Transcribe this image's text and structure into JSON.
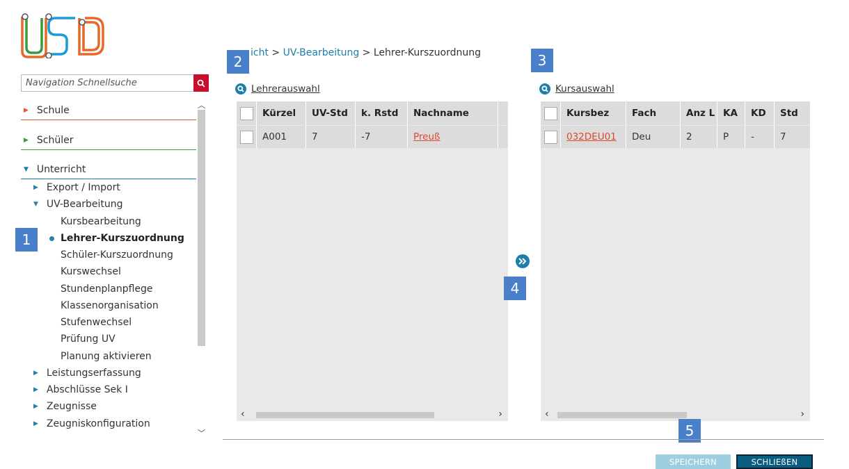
{
  "sidebar": {
    "search_placeholder": "Navigation Schnellsuche",
    "top_items": [
      {
        "label": "Schule",
        "color": "#e05a2b",
        "expanded": false
      },
      {
        "label": "Schüler",
        "color": "#3a9b3a",
        "expanded": false
      },
      {
        "label": "Unterricht",
        "color": "#1b7fa8",
        "expanded": true
      }
    ],
    "sub_items": [
      {
        "label": "Export / Import"
      },
      {
        "label": "UV-Bearbeitung"
      },
      {
        "label": "Leistungserfassung"
      },
      {
        "label": "Abschlüsse Sek I"
      },
      {
        "label": "Zeugnisse"
      },
      {
        "label": "Zeugniskonfiguration"
      }
    ],
    "uv_children": [
      {
        "label": "Kursbearbeitung",
        "active": false
      },
      {
        "label": "Lehrer-Kurszuordnung",
        "active": true
      },
      {
        "label": "Schüler-Kurszuordnung",
        "active": false
      },
      {
        "label": "Kurswechsel",
        "active": false
      },
      {
        "label": "Stundenplanpflege",
        "active": false
      },
      {
        "label": "Klassenorganisation",
        "active": false
      },
      {
        "label": "Stufenwechsel",
        "active": false
      },
      {
        "label": "Prüfung UV",
        "active": false
      },
      {
        "label": "Planung aktivieren",
        "active": false
      }
    ]
  },
  "badges": [
    "1",
    "2",
    "3",
    "4",
    "5"
  ],
  "breadcrumb": {
    "part1": "icht",
    "sep1": " > ",
    "part2": "UV-Bearbeitung",
    "sep2": " > ",
    "current": "Lehrer-Kurszuordnung"
  },
  "teachers": {
    "title": "Lehrerauswahl",
    "columns": [
      "Kürzel",
      "UV-Std",
      "k. Rstd",
      "Nachname"
    ],
    "rows": [
      {
        "kuerzel": "A001",
        "uv_std": "7",
        "k_rstd": "-7",
        "nachname": "Preuß"
      }
    ]
  },
  "courses": {
    "title": "Kursauswahl",
    "columns": [
      "Kursbez",
      "Fach",
      "Anz L",
      "KA",
      "KD",
      "Std"
    ],
    "rows": [
      {
        "kursbez": "032DEU01",
        "fach": "Deu",
        "anz_l": "2",
        "ka": "P",
        "kd": "-",
        "std": "7"
      }
    ]
  },
  "footer": {
    "save_label": "SPEICHERN",
    "close_label": "SCHLIEßEN"
  },
  "colors": {
    "accent": "#1b7fa8",
    "brand_red": "#c8102e",
    "link": "#e0482a"
  }
}
